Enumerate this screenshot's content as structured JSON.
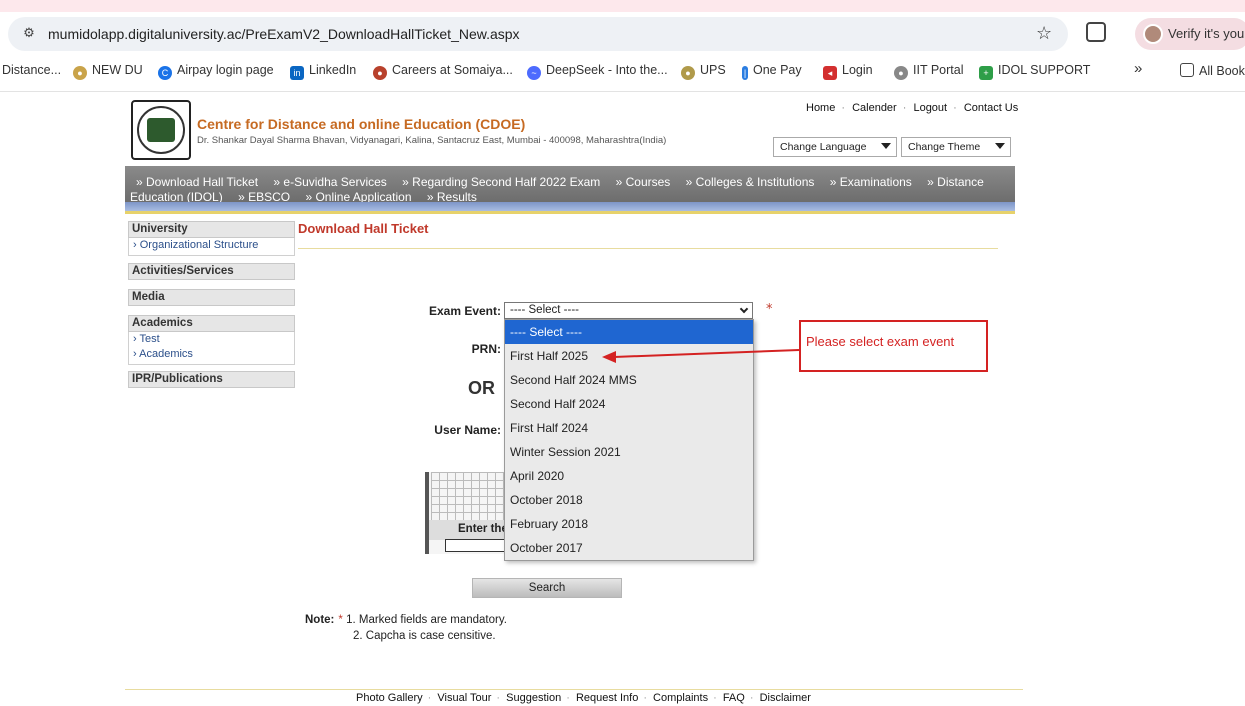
{
  "browser": {
    "url": "mumidolapp.digitaluniversity.ac/PreExamV2_DownloadHallTicket_New.aspx",
    "verify_label": "Verify it's you",
    "bookmarks": [
      "Distance...",
      "NEW DU",
      "Airpay login page",
      "LinkedIn",
      "Careers at Somaiya...",
      "DeepSeek - Into the...",
      "UPS",
      "One Pay",
      "Login",
      "IIT Portal",
      "IDOL SUPPORT",
      "All Bookmarks"
    ],
    "more": "»"
  },
  "header": {
    "title": "Centre for Distance and online Education (CDOE)",
    "address": "Dr. Shankar Dayal Sharma Bhavan, Vidyanagari, Kalina, Santacruz East, Mumbai - 400098, Maharashtra(India)",
    "links": [
      "Home",
      "Calender",
      "Logout",
      "Contact Us"
    ],
    "change_language": "Change Language",
    "change_theme": "Change Theme"
  },
  "nav": {
    "row1": [
      "» Download Hall Ticket",
      "» e-Suvidha Services",
      "» Regarding Second Half 2022 Exam",
      "» Courses",
      "» Colleges & Institutions",
      "» Examinations",
      "» Distance"
    ],
    "row2": [
      "Education (IDOL)",
      "» EBSCO",
      "» Online Application",
      "» Results"
    ]
  },
  "sidebar": {
    "university": {
      "title": "University",
      "items": [
        "Organizational Structure"
      ]
    },
    "activities": {
      "title": "Activities/Services"
    },
    "media": {
      "title": "Media"
    },
    "academics": {
      "title": "Academics",
      "items": [
        "Test",
        "Academics"
      ]
    },
    "ipr": {
      "title": "IPR/Publications"
    }
  },
  "form": {
    "page_title": "Download Hall Ticket",
    "exam_event_label": "Exam Event:",
    "exam_event_value": "---- Select ----",
    "required_mark": "*",
    "prn_label": "PRN:",
    "or_text": "OR",
    "username_label": "User Name:",
    "captcha_prompt": "Enter the",
    "search_label": "Search",
    "options": [
      "---- Select ----",
      "First Half 2025",
      "Second Half 2024 MMS",
      "Second Half 2024",
      "First Half 2024",
      "Winter Session 2021",
      "April 2020",
      "October 2018",
      "February 2018",
      "October 2017"
    ]
  },
  "annotation": {
    "text": "Please select exam event",
    "color": "#d42222"
  },
  "note": {
    "label": "Note:",
    "star": "*",
    "line1": "1. Marked fields are mandatory.",
    "line2": "2. Capcha is case censitive."
  },
  "footer": {
    "links": [
      "Photo Gallery",
      "Visual Tour",
      "Suggestion",
      "Request Info",
      "Complaints",
      "FAQ",
      "Disclaimer"
    ]
  },
  "colors": {
    "accent": "#c66a22",
    "title_red": "#c0392b",
    "nav_gray": "#7a7a7a",
    "selected_blue": "#1f66d1"
  }
}
